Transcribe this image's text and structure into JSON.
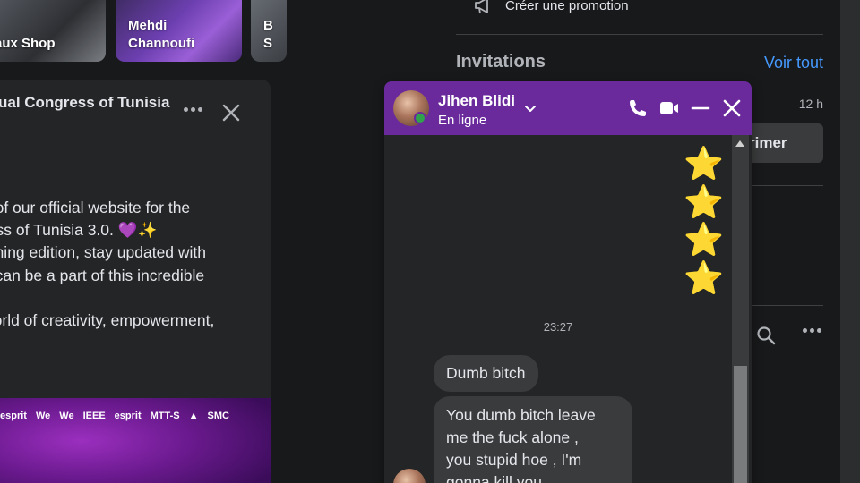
{
  "stories": [
    {
      "label": "aux Shop"
    },
    {
      "label_line1": "Mehdi",
      "label_line2": "Channoufi"
    },
    {
      "label_line1": "B",
      "label_line2": "S"
    }
  ],
  "post": {
    "title": "ual Congress of Tunisia",
    "lines": [
      "h of our official website for the",
      "ress of Tunisia 3.0. 💜✨",
      "oming edition, stay updated with",
      "u can be a part of this incredible",
      "",
      "world of creativity, empowerment,"
    ],
    "banner_logos": [
      "esprit",
      "We",
      "We",
      "IEEE",
      "esprit",
      "MTT-S",
      "",
      "SMC"
    ]
  },
  "right": {
    "promo_label": "Créer une promotion",
    "invitations_title": "Invitations",
    "see_all": "Voir tout",
    "invite_time": "12 h",
    "invite_button": "rimer"
  },
  "chat": {
    "name": "Jihen Blidi",
    "status": "En ligne",
    "star_emoji": "⭐",
    "timestamp": "23:27",
    "messages": [
      {
        "text": "Dumb bitch"
      },
      {
        "lines": [
          "You dumb bitch leave",
          "me the fuck alone ,",
          "you stupid hoe , I'm",
          "gonna kill you"
        ]
      }
    ],
    "colors": {
      "header": "#6a2a9c",
      "bubble": "#3a3b3c",
      "online": "#31a24c",
      "link": "#4599ff"
    }
  }
}
